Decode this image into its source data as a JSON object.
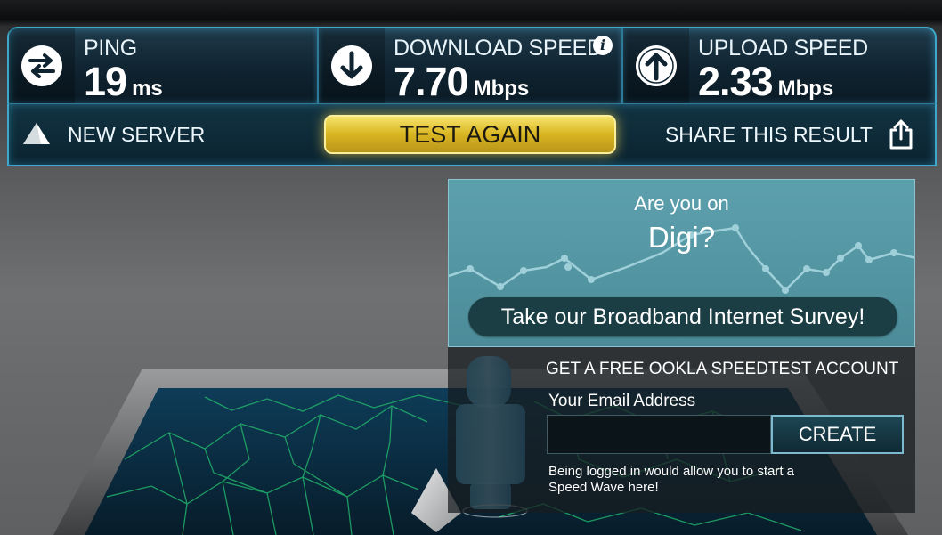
{
  "stats": {
    "ping": {
      "title": "PING",
      "value": "19",
      "unit": "ms",
      "icon": "ping-arrows-icon"
    },
    "download": {
      "title": "DOWNLOAD SPEED",
      "value": "7.70",
      "unit": "Mbps",
      "icon": "download-arrow-icon",
      "info": "i"
    },
    "upload": {
      "title": "UPLOAD SPEED",
      "value": "2.33",
      "unit": "Mbps",
      "icon": "upload-arrow-icon"
    }
  },
  "actions": {
    "new_server": "NEW SERVER",
    "test_again": "TEST AGAIN",
    "share": "SHARE THIS RESULT"
  },
  "survey": {
    "question_line1": "Are you on",
    "question_line2": "Digi?",
    "button": "Take our Broadband Internet Survey!"
  },
  "account": {
    "title": "GET A FREE OOKLA SPEEDTEST ACCOUNT",
    "email_label": "Your Email Address",
    "email_value": "",
    "create_button": "CREATE",
    "note": "Being logged in would allow you to start a Speed Wave here!"
  },
  "colors": {
    "accent": "#3fa7c9",
    "button_gold": "#d9b521",
    "survey_bg": "#5da0ad"
  }
}
